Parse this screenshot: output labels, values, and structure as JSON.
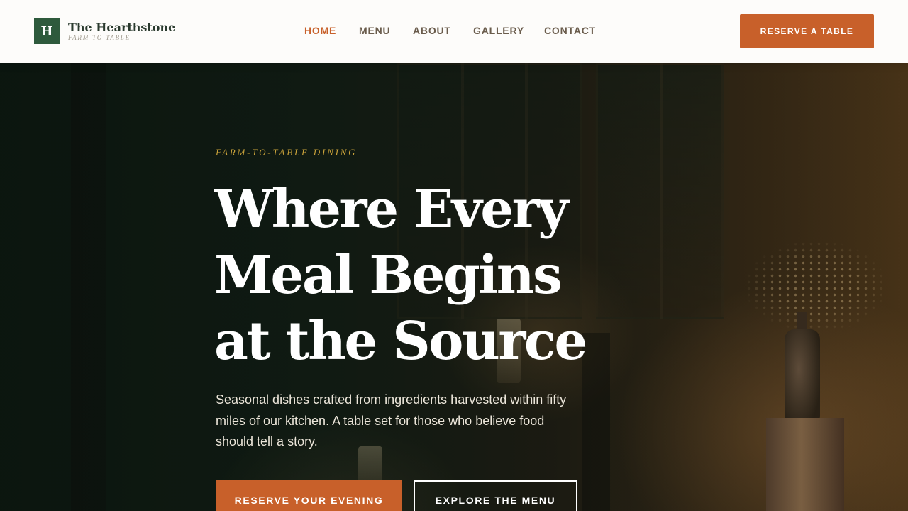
{
  "brand": {
    "mark": "H",
    "name": "The Hearthstone",
    "tagline": "FARM TO TABLE",
    "color": "#2e5a3c"
  },
  "nav": {
    "items": [
      {
        "label": "HOME",
        "active": true
      },
      {
        "label": "MENU",
        "active": false
      },
      {
        "label": "ABOUT",
        "active": false
      },
      {
        "label": "GALLERY",
        "active": false
      },
      {
        "label": "CONTACT",
        "active": false
      }
    ],
    "active_color": "#c8602a",
    "cta_label": "RESERVE A TABLE"
  },
  "hero": {
    "eyebrow": "FARM-TO-TABLE DINING",
    "headline_lines": [
      "Where Every",
      "Meal Begins",
      "at the Source"
    ],
    "description": "Seasonal dishes crafted from ingredients harvested within fifty miles of our kitchen. A table set for those who believe food should tell a story.",
    "primary_cta": "RESERVE YOUR EVENING",
    "secondary_cta": "EXPLORE THE MENU",
    "accent_color": "#c9a23a"
  },
  "colors": {
    "accent": "#c8602a",
    "header_bg": "#fdfcfa"
  }
}
